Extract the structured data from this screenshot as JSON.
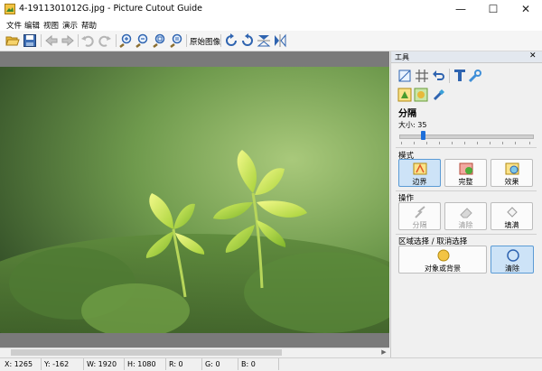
{
  "window": {
    "title": "4-1911301012G.jpg - Picture Cutout Guide",
    "minimize_glyph": "—",
    "maximize_glyph": "☐",
    "close_glyph": "✕"
  },
  "menu": [
    "文件",
    "编辑",
    "视图",
    "演示",
    "帮助"
  ],
  "toolbar": {
    "original_image_label": "原始图像",
    "icons": [
      "open-icon",
      "save-icon",
      "back-icon",
      "forward-icon",
      "undo-icon",
      "redo-icon",
      "zoom-in-icon",
      "zoom-out-icon",
      "zoom-fit-icon",
      "zoom-actual-icon",
      "rotate-right-icon",
      "rotate-left-icon",
      "flip-vertical-icon",
      "flip-horizontal-icon"
    ]
  },
  "panel": {
    "title": "工具",
    "close_glyph": "✕",
    "section_title": "分隔",
    "size_label": "大小: 35",
    "size_value": 35,
    "mode_label": "模式",
    "mode_buttons": [
      "边界",
      "完整",
      "效果"
    ],
    "operation_label": "操作",
    "operation_buttons": [
      "分隔",
      "清除",
      "填满"
    ],
    "region_label": "区域选择 / 取消选择",
    "region_buttons": [
      "对象或背景",
      "清除"
    ]
  },
  "status": {
    "x": "X: 1265",
    "y": "Y: -162",
    "w": "W: 1920",
    "h": "H: 1080",
    "r": "R: 0",
    "g": "G: 0",
    "b": "B: 0"
  },
  "colors": {
    "accent": "#1e6fd9",
    "active_button": "#cde3f7",
    "canvas_bg": "#7a7a7a"
  }
}
